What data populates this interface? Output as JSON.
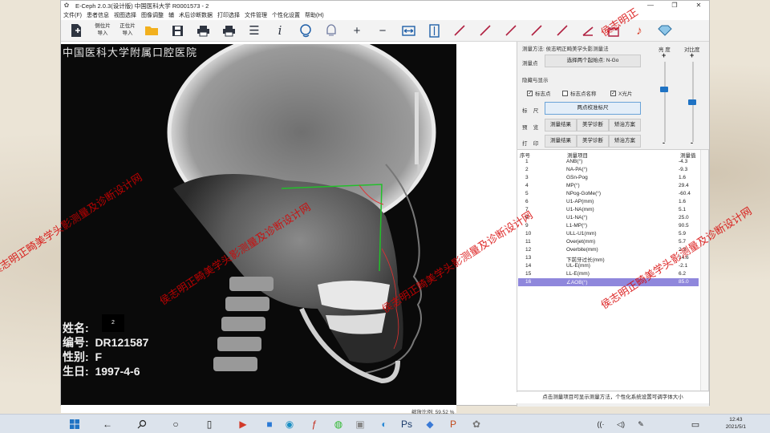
{
  "window": {
    "title": "E-Ceph 2.0.3(设计版)    中国医科大学        R0001573   -   2",
    "controls": [
      "—",
      "❐",
      "✕"
    ]
  },
  "menu": [
    "文件(F)",
    "患者信息",
    "视图选择",
    "图像调整",
    "辅",
    "术后诊断数据",
    "打印选择",
    "文件管理",
    "个性化设置",
    "帮助(H)"
  ],
  "toolbar": {
    "lateral_import": "侧位片\n导入",
    "frontal_import": "正位片\n导入"
  },
  "xray": {
    "hospital": "中国医科大学附属口腔医院",
    "name_label": "姓名:",
    "name_box": "2",
    "id_line": "编号:  DR121587",
    "sex_line": "性别:  F",
    "dob_line": "生日:  1997-4-6",
    "zoom": "缩放比例: 59.52 %"
  },
  "panel": {
    "method": "测量方法: 侯志明正畸美学头影测量法",
    "point_label": "测量点",
    "point_button": "选择两个起始点: N-Go",
    "hide_label": "隐藏与显示",
    "chk_landmark": "标志点",
    "chk_landmark_name": "标志点名称",
    "chk_xray": "X光片",
    "ruler_label": "标    尺",
    "ruler_button": "两点校准标尺",
    "preview_label": "预    览",
    "print_label": "打    印",
    "btn_result": "测量结果",
    "btn_aesthetic": "美学诊断",
    "btn_correct": "矫治方案",
    "slider_brightness": "亮 度",
    "slider_contrast": "对比度",
    "plus": "+",
    "minus": "-"
  },
  "table": {
    "headers": [
      "序号",
      "测量项目",
      "测量值"
    ],
    "rows": [
      [
        "1",
        "ANB(°)",
        "-4.3"
      ],
      [
        "2",
        "NA-PA(°)",
        "-9.3"
      ],
      [
        "3",
        "GSn-Pog",
        "1.6"
      ],
      [
        "4",
        "MP(°)",
        "29.4"
      ],
      [
        "5",
        "NPog-GoMe(°)",
        "-60.4"
      ],
      [
        "6",
        "U1-AP(mm)",
        "1.6"
      ],
      [
        "7",
        "U1-NA(mm)",
        "5.1"
      ],
      [
        "8",
        "U1-NA(°)",
        "25.0"
      ],
      [
        "9",
        "L1-MP(°)",
        "90.5"
      ],
      [
        "10",
        "ULL-U1(mm)",
        "5.9"
      ],
      [
        "11",
        "Overjet(mm)",
        "5.7"
      ],
      [
        "12",
        "Overbite(mm)",
        "2.3"
      ],
      [
        "13",
        "下前牙过长(mm)",
        "14.6"
      ],
      [
        "14",
        "UL-E(mm)",
        "-2.1"
      ],
      [
        "15",
        "LL-E(mm)",
        "6.2"
      ],
      [
        "16",
        "∠AOB(°)",
        "85.0"
      ]
    ],
    "selected_index": 15
  },
  "hint": "点击测量项目可显示测量方法，个性化系统设置可调字体大小",
  "watermarks": [
    "侯志明正畸美学头影测量及诊断设计网",
    "侯志明正畸美学头影测量及诊断设计网",
    "侯志明正畸美学头影测量及诊断设计网",
    "侯志明正畸美学头影测量及诊断设计网",
    "侯志明正"
  ],
  "taskbar": {
    "time": "12:43",
    "date": "2021/5/1"
  },
  "colors": {
    "accent": "#1f73c4",
    "selected_row": "#8f87dc",
    "watermark": "#d70000",
    "tracing": "#22c02a"
  }
}
